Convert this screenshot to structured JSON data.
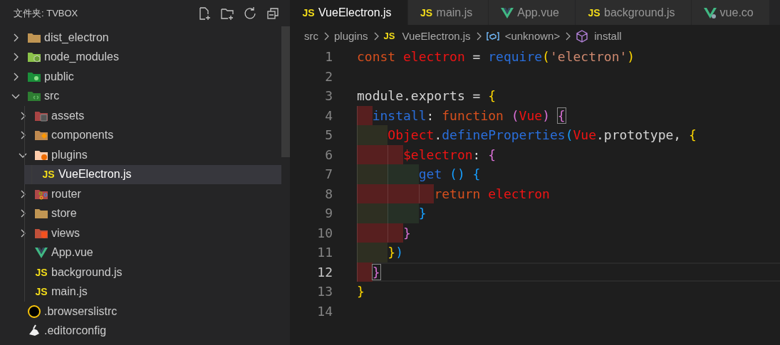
{
  "explorer": {
    "title": "文件夹: TVBOX",
    "actions": [
      {
        "kind": "new-file"
      },
      {
        "kind": "new-folder"
      },
      {
        "kind": "refresh"
      },
      {
        "kind": "collapse"
      }
    ],
    "tree": [
      {
        "label": "dist_electron",
        "kind": "folder",
        "expanded": false,
        "selected": false
      },
      {
        "label": "node_modules",
        "kind": "folder-node",
        "expanded": false,
        "selected": false
      },
      {
        "label": "public",
        "kind": "folder-public",
        "expanded": false,
        "selected": false
      },
      {
        "label": "src",
        "kind": "folder-src",
        "expanded": true,
        "selected": false,
        "children": [
          {
            "label": "assets",
            "kind": "folder-assets",
            "expanded": false,
            "selected": false
          },
          {
            "label": "components",
            "kind": "folder-components",
            "expanded": false,
            "selected": false
          },
          {
            "label": "plugins",
            "kind": "folder-plugins",
            "expanded": true,
            "selected": false,
            "children": [
              {
                "label": "VueElectron.js",
                "kind": "js",
                "badge": "JS",
                "selected": true
              }
            ]
          },
          {
            "label": "router",
            "kind": "folder-router",
            "expanded": false,
            "selected": false
          },
          {
            "label": "store",
            "kind": "folder",
            "expanded": false,
            "selected": false
          },
          {
            "label": "views",
            "kind": "folder-views",
            "expanded": false,
            "selected": false
          },
          {
            "label": "App.vue",
            "kind": "vue",
            "selected": false
          },
          {
            "label": "background.js",
            "kind": "js",
            "badge": "JS",
            "selected": false
          },
          {
            "label": "main.js",
            "kind": "js",
            "badge": "JS",
            "selected": false
          }
        ]
      },
      {
        "label": ".browserslistrc",
        "kind": "browserslist",
        "selected": false
      },
      {
        "label": ".editorconfig",
        "kind": "editorconfig",
        "selected": false
      }
    ]
  },
  "tabs": [
    {
      "label": "VueElectron.js",
      "kind": "js",
      "badge": "JS",
      "selected": true
    },
    {
      "label": "main.js",
      "kind": "js",
      "badge": "JS",
      "selected": false
    },
    {
      "label": "App.vue",
      "kind": "vue",
      "selected": false
    },
    {
      "label": "background.js",
      "kind": "js",
      "badge": "JS",
      "selected": false
    },
    {
      "label": "vue.co",
      "kind": "vue-config",
      "selected": false
    }
  ],
  "breadcrumb": [
    {
      "label": "src",
      "kind": "folder"
    },
    {
      "label": "plugins",
      "kind": "folder"
    },
    {
      "label": "VueElectron.js",
      "kind": "js",
      "badge": "JS"
    },
    {
      "label": "<unknown>",
      "kind": "variable"
    },
    {
      "label": "install",
      "kind": "method"
    }
  ],
  "code": [
    {
      "number": "1",
      "current": false,
      "tokens": [
        {
          "kind": "keyword",
          "text": "const "
        },
        {
          "kind": "variable",
          "text": "electron"
        },
        {
          "kind": "plain",
          "text": " = "
        },
        {
          "kind": "function",
          "text": "require"
        },
        {
          "kind": "brace1",
          "text": "("
        },
        {
          "kind": "string",
          "text": "'electron'"
        },
        {
          "kind": "brace1",
          "text": ")"
        }
      ]
    },
    {
      "number": "2",
      "current": false
    },
    {
      "number": "3",
      "current": false,
      "tokens": [
        {
          "kind": "plain",
          "text": "module.exports = "
        },
        {
          "kind": "brace1",
          "text": "{"
        }
      ]
    },
    {
      "number": "4",
      "current": false,
      "indent": [
        {
          "kind": "error-half"
        }
      ],
      "tokens": [
        {
          "kind": "function",
          "text": "install"
        },
        {
          "kind": "plain",
          "text": ": "
        },
        {
          "kind": "keyword",
          "text": "function "
        },
        {
          "kind": "brace2",
          "text": "("
        },
        {
          "kind": "variable",
          "text": "Vue"
        },
        {
          "kind": "brace2",
          "text": ") "
        },
        {
          "kind": "brace2",
          "text": "{",
          "matched": true
        }
      ]
    },
    {
      "number": "5",
      "current": false,
      "indent": [
        {
          "kind": "odd"
        }
      ],
      "tokens": [
        {
          "kind": "variable",
          "text": "Object"
        },
        {
          "kind": "plain",
          "text": "."
        },
        {
          "kind": "function",
          "text": "defineProperties"
        },
        {
          "kind": "brace3",
          "text": "("
        },
        {
          "kind": "variable",
          "text": "Vue"
        },
        {
          "kind": "plain",
          "text": ".prototype, "
        },
        {
          "kind": "brace1",
          "text": "{"
        }
      ]
    },
    {
      "number": "6",
      "current": false,
      "indent": [
        {
          "kind": "error"
        },
        {
          "kind": "error-half"
        }
      ],
      "tokens": [
        {
          "kind": "variable",
          "text": "$electron"
        },
        {
          "kind": "plain",
          "text": ": "
        },
        {
          "kind": "brace2",
          "text": "{"
        }
      ]
    },
    {
      "number": "7",
      "current": false,
      "indent": [
        {
          "kind": "odd"
        },
        {
          "kind": "even"
        }
      ],
      "tokens": [
        {
          "kind": "function",
          "text": "get "
        },
        {
          "kind": "brace3",
          "text": "() "
        },
        {
          "kind": "brace3",
          "text": "{"
        }
      ]
    },
    {
      "number": "8",
      "current": false,
      "indent": [
        {
          "kind": "error"
        },
        {
          "kind": "error"
        },
        {
          "kind": "error-half"
        }
      ],
      "tokens": [
        {
          "kind": "keyword",
          "text": "return "
        },
        {
          "kind": "variable",
          "text": "electron"
        }
      ]
    },
    {
      "number": "9",
      "current": false,
      "indent": [
        {
          "kind": "odd"
        },
        {
          "kind": "even"
        }
      ],
      "tokens": [
        {
          "kind": "brace3",
          "text": "}"
        }
      ]
    },
    {
      "number": "10",
      "current": false,
      "indent": [
        {
          "kind": "error"
        },
        {
          "kind": "error-half"
        }
      ],
      "tokens": [
        {
          "kind": "brace2",
          "text": "}"
        }
      ]
    },
    {
      "number": "11",
      "current": false,
      "indent": [
        {
          "kind": "odd"
        }
      ],
      "tokens": [
        {
          "kind": "brace1",
          "text": "}"
        },
        {
          "kind": "brace3",
          "text": ")"
        }
      ]
    },
    {
      "number": "12",
      "current": true,
      "indent": [
        {
          "kind": "error-half"
        }
      ],
      "tokens": [
        {
          "kind": "brace2",
          "text": "}",
          "matched": true
        }
      ]
    },
    {
      "number": "13",
      "current": false,
      "tokens": [
        {
          "kind": "brace1",
          "text": "}"
        }
      ]
    },
    {
      "number": "14",
      "current": false
    }
  ]
}
